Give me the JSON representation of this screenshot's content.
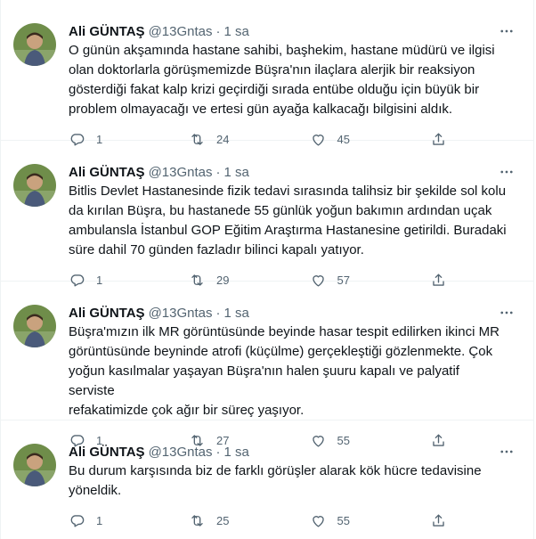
{
  "tweets": [
    {
      "name": "Ali GÜNTAŞ",
      "handle": "@13Gntas",
      "dot": "·",
      "time": "1 sa",
      "text": "O günün akşamında hastane sahibi, başhekim, hastane müdürü ve ilgisi\nolan doktorlarla görüşmemizde Büşra'nın ilaçlara alerjik bir reaksiyon\ngösterdiği fakat kalp krizi geçirdiği sırada entübe olduğu için büyük bir\nproblem olmayacağı ve ertesi gün ayağa kalkacağı bilgisini aldık.",
      "replies": "1",
      "retweets": "24",
      "likes": "45"
    },
    {
      "name": "Ali GÜNTAŞ",
      "handle": "@13Gntas",
      "dot": "·",
      "time": "1 sa",
      "text": "Bitlis Devlet Hastanesinde fizik tedavi sırasında talihsiz bir şekilde sol kolu\nda kırılan Büşra, bu hastanede 55 günlük yoğun bakımın ardından uçak\nambulansla İstanbul GOP Eğitim Araştırma Hastanesine getirildi. Buradaki\nsüre dahil 70 günden fazladır bilinci kapalı yatıyor.",
      "replies": "1",
      "retweets": "29",
      "likes": "57"
    },
    {
      "name": "Ali GÜNTAŞ",
      "handle": "@13Gntas",
      "dot": "·",
      "time": "1 sa",
      "text": "Büşra'mızın ilk MR görüntüsünde beyinde hasar tespit edilirken ikinci MR\ngörüntüsünde beyninde atrofi (küçülme) gerçekleştiği gözlenmekte. Çok\nyoğun kasılmalar yaşayan Büşra'nın halen şuuru kapalı ve palyatif serviste\nrefakatimizde çok ağır bir süreç yaşıyor.",
      "replies": "1",
      "retweets": "27",
      "likes": "55"
    },
    {
      "name": "Ali GÜNTAŞ",
      "handle": "@13Gntas",
      "dot": "·",
      "time": "1 sa",
      "text": "Bu durum karşısında biz de farklı görüşler alarak kök hücre tedavisine\nyöneldik.",
      "replies": "1",
      "retweets": "25",
      "likes": "55"
    }
  ],
  "icons": {
    "more": "more-horizontal-icon",
    "reply": "reply-icon",
    "retweet": "retweet-icon",
    "like": "heart-icon",
    "share": "share-icon"
  },
  "colors": {
    "text": "#0f1419",
    "secondary": "#536471",
    "divider": "#eff3f4"
  }
}
